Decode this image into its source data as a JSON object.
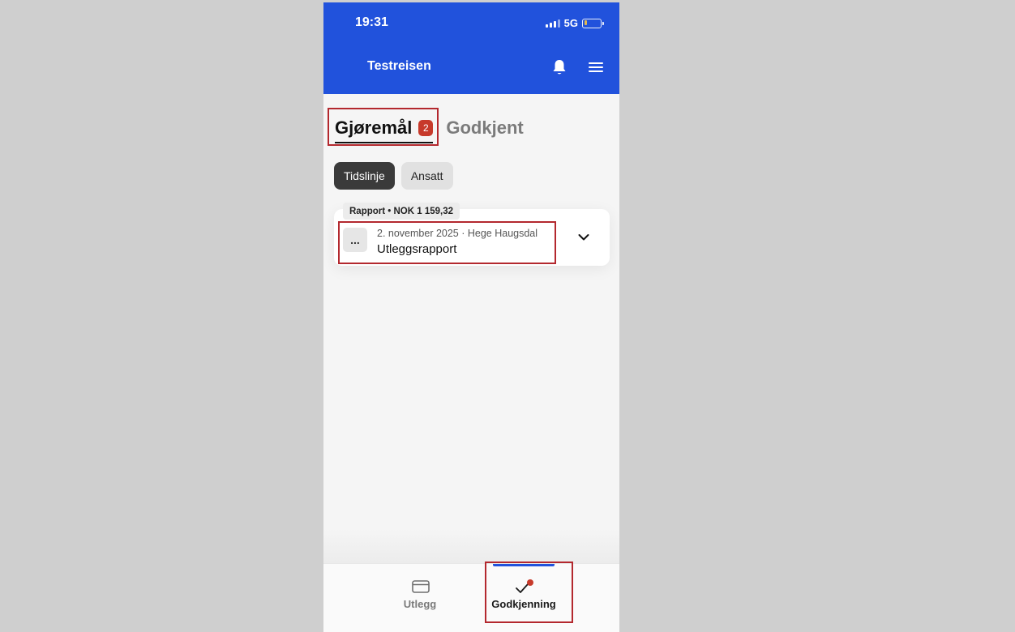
{
  "status_bar": {
    "time": "19:31",
    "network": "5G"
  },
  "header": {
    "title": "Testreisen"
  },
  "tabs": [
    {
      "label": "Gjøremål",
      "badge": "2",
      "active": true
    },
    {
      "label": "Godkjent",
      "active": false
    }
  ],
  "filters": [
    {
      "label": "Tidslinje",
      "active": true
    },
    {
      "label": "Ansatt",
      "active": false
    }
  ],
  "items": [
    {
      "tag": "Rapport • NOK 1 159,32",
      "more": "...",
      "meta": "2. november 2025 · Hege Haugsdal",
      "title": "Utleggsrapport"
    }
  ],
  "bottom_nav": [
    {
      "label": "Utlegg",
      "icon": "credit-card-icon",
      "active": false
    },
    {
      "label": "Godkjenning",
      "icon": "check-icon",
      "active": true
    }
  ],
  "colors": {
    "primary": "#2152dc",
    "badge": "#c73a2b",
    "highlight": "#b3282e",
    "background": "#f5f5f5"
  }
}
